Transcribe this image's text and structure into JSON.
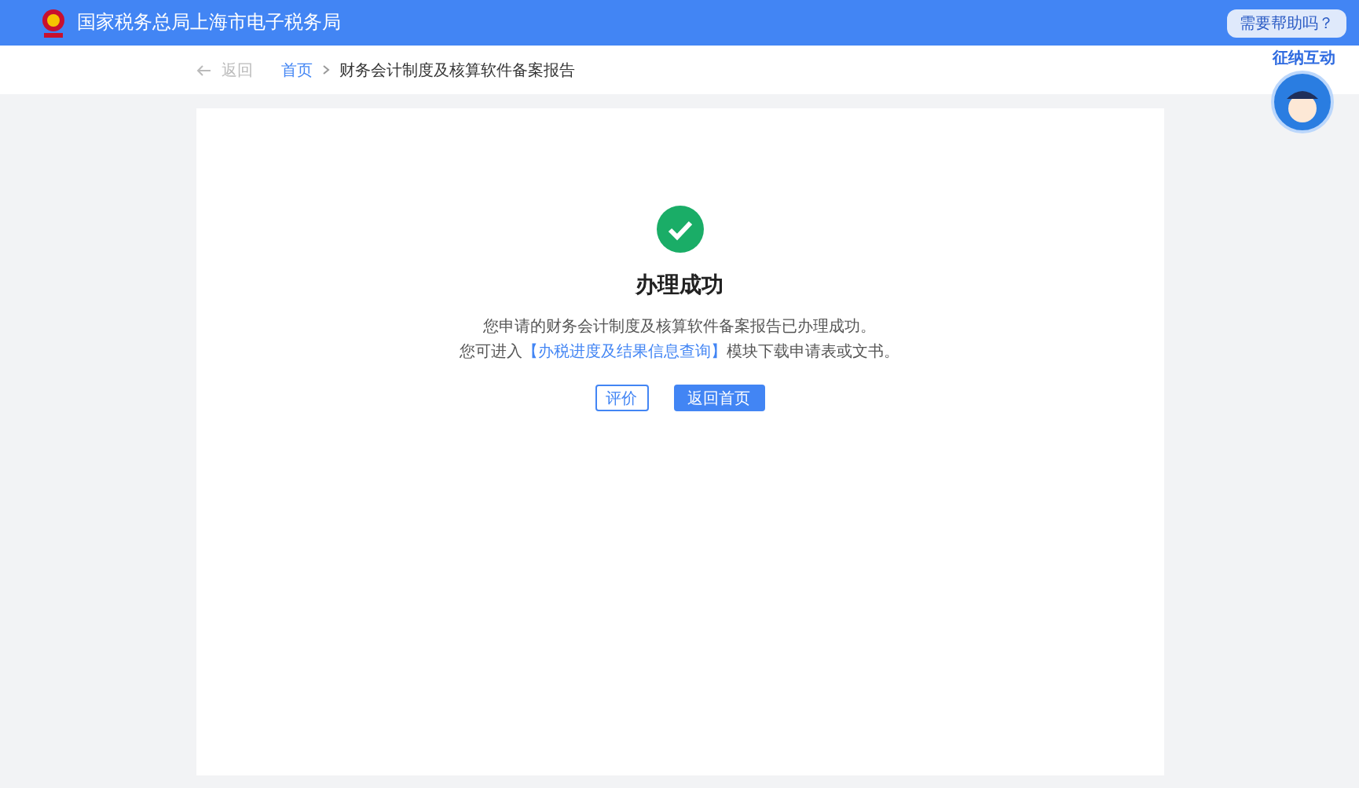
{
  "header": {
    "title": "国家税务总局上海市电子税务局"
  },
  "breadcrumb": {
    "back": "返回",
    "items": [
      {
        "label": "首页",
        "kind": "link"
      },
      {
        "label": "财务会计制度及核算软件备案报告",
        "kind": "current"
      }
    ]
  },
  "result": {
    "title": "办理成功",
    "line1": "您申请的财务会计制度及核算软件备案报告已办理成功。",
    "line2_before": "您可进入",
    "line2_link": "【办税进度及结果信息查询】",
    "line2_after": "模块下载申请表或文书。"
  },
  "buttons": [
    {
      "label": "评价",
      "kind": "secondary"
    },
    {
      "label": "返回首页",
      "kind": "primary"
    }
  ],
  "assistant": {
    "bubble": "需要帮助吗？",
    "badge": "征纳互动"
  }
}
